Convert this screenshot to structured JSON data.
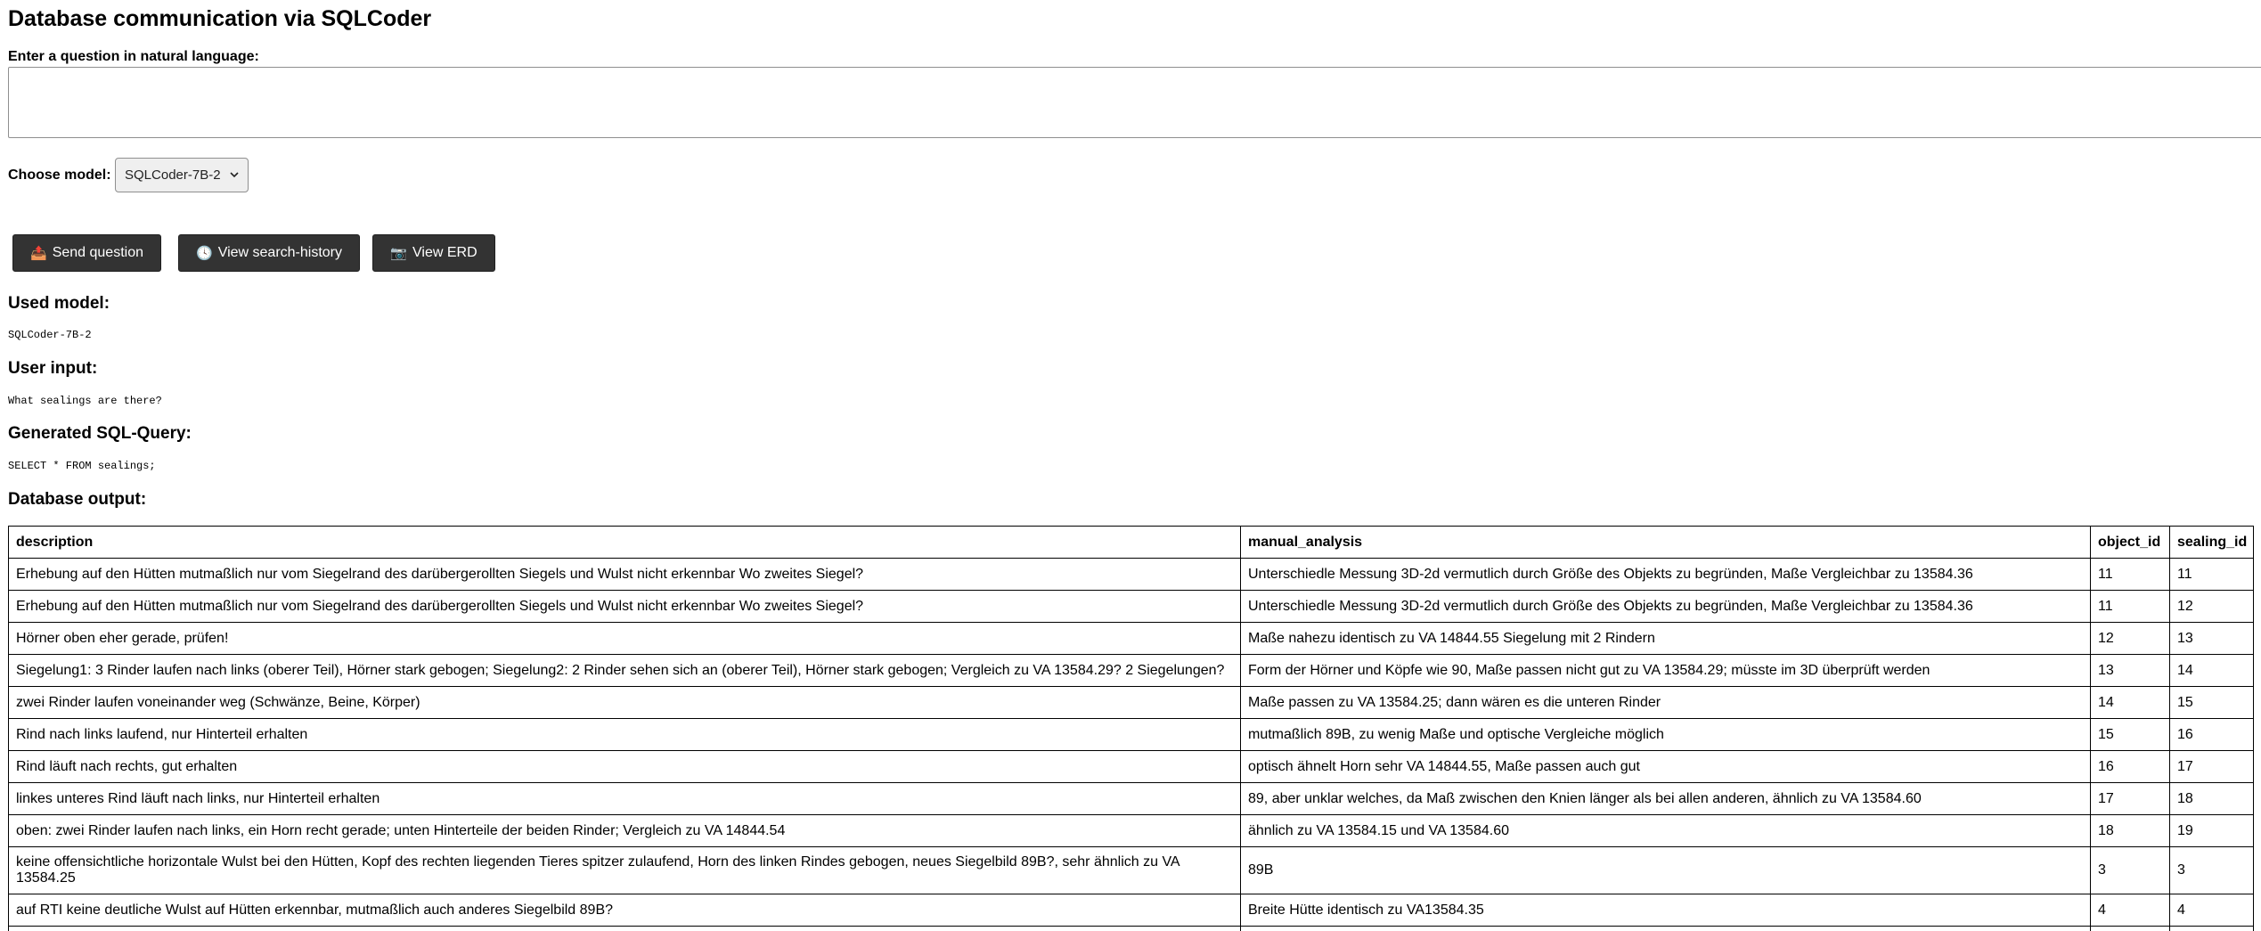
{
  "page": {
    "title": "Database communication via SQLCoder"
  },
  "question": {
    "label": "Enter a question in natural language:",
    "value": "",
    "placeholder": ""
  },
  "model": {
    "label": "Choose model:",
    "selected": "SQLCoder-7B-2",
    "chevron_icon": "chevron-down-icon"
  },
  "buttons": {
    "send": {
      "icon": "📤",
      "icon_name": "outbox-tray-icon",
      "label": "Send question"
    },
    "history": {
      "icon": "🕓",
      "icon_name": "clock-icon",
      "label": "View search-history"
    },
    "erd": {
      "icon": "📷",
      "icon_name": "camera-icon",
      "label": "View ERD"
    }
  },
  "results": {
    "used_model_heading": "Used model:",
    "used_model_value": "SQLCoder-7B-2",
    "user_input_heading": "User input:",
    "user_input_value": "What sealings are there?",
    "sql_heading": "Generated SQL-Query:",
    "sql_value": "SELECT * FROM sealings;",
    "db_heading": "Database output:"
  },
  "table": {
    "headers": [
      "description",
      "manual_analysis",
      "object_id",
      "sealing_id"
    ],
    "rows": [
      [
        "Erhebung auf den Hütten mutmaßlich nur vom Siegelrand des darübergerollten Siegels und Wulst nicht erkennbar Wo zweites Siegel?",
        "Unterschiedle Messung 3D-2d vermutlich durch Größe des Objekts zu begründen, Maße Vergleichbar zu 13584.36",
        "11",
        "11"
      ],
      [
        "Erhebung auf den Hütten mutmaßlich nur vom Siegelrand des darübergerollten Siegels und Wulst nicht erkennbar Wo zweites Siegel?",
        "Unterschiedle Messung 3D-2d vermutlich durch Größe des Objekts zu begründen, Maße Vergleichbar zu 13584.36",
        "11",
        "12"
      ],
      [
        "Hörner oben eher gerade, prüfen!",
        "Maße nahezu identisch zu VA 14844.55 Siegelung mit 2 Rindern",
        "12",
        "13"
      ],
      [
        "Siegelung1: 3 Rinder laufen nach links (oberer Teil), Hörner stark gebogen; Siegelung2: 2 Rinder sehen sich an (oberer Teil), Hörner stark gebogen; Vergleich zu VA 13584.29? 2 Siegelungen?",
        "Form der Hörner und Köpfe wie 90, Maße passen nicht gut zu VA 13584.29; müsste im 3D überprüft werden",
        "13",
        "14"
      ],
      [
        "zwei Rinder laufen voneinander weg (Schwänze, Beine, Körper)",
        "Maße passen zu VA 13584.25; dann wären es die unteren Rinder",
        "14",
        "15"
      ],
      [
        "Rind nach links laufend, nur Hinterteil erhalten",
        "mutmaßlich 89B, zu wenig Maße und optische Vergleiche möglich",
        "15",
        "16"
      ],
      [
        "Rind läuft nach rechts, gut erhalten",
        "optisch ähnelt Horn sehr VA 14844.55, Maße passen auch gut",
        "16",
        "17"
      ],
      [
        "linkes unteres Rind läuft nach links, nur Hinterteil erhalten",
        "89, aber unklar welches, da Maß zwischen den Knien länger als bei allen anderen, ähnlich zu VA 13584.60",
        "17",
        "18"
      ],
      [
        "oben: zwei Rinder laufen nach links, ein Horn recht gerade; unten Hinterteile der beiden Rinder; Vergleich zu VA 14844.54",
        "ähnlich zu VA 13584.15 und VA 13584.60",
        "18",
        "19"
      ],
      [
        "keine offensichtliche horizontale Wulst bei den Hütten, Kopf des rechten liegenden Tieres spitzer zulaufend, Horn des linken Rindes gebogen, neues Siegelbild 89B?, sehr ähnlich zu VA 13584.25",
        "89B",
        "3",
        "3"
      ],
      [
        "auf RTI keine deutliche Wulst auf Hütten erkennbar, mutmaßlich auch anderes Siegelbild 89B?",
        "Breite Hütte identisch zu VA13584.35",
        "4",
        "4"
      ],
      [
        "",
        "",
        "",
        ""
      ]
    ]
  }
}
